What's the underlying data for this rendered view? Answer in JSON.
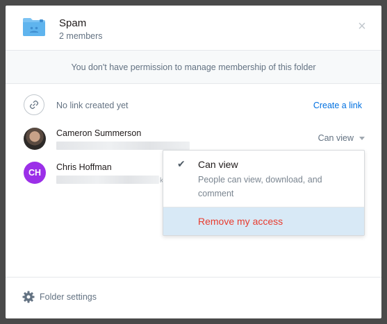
{
  "header": {
    "title": "Spam",
    "subtitle": "2 members",
    "folder_icon": "shared-folder-icon",
    "close_label": "×"
  },
  "banner": {
    "text": "You don't have permission to manage membership of this folder"
  },
  "link": {
    "icon": "link-icon",
    "status": "No link created yet",
    "create_label": "Create a link"
  },
  "members": [
    {
      "name": "Cameron Summerson",
      "avatar": "photo",
      "access": "Can view"
    },
    {
      "name": "Chris Hoffman",
      "avatar_initials": "CH",
      "avatar_color": "#9b2fe8",
      "email_tail": "k"
    }
  ],
  "access_dropdown": {
    "options": [
      {
        "label": "Can view",
        "description": "People can view, download, and comment",
        "selected": true
      },
      {
        "label": "Remove my access",
        "highlighted": true
      }
    ]
  },
  "footer": {
    "icon": "gear-icon",
    "label": "Folder settings"
  },
  "colors": {
    "accent": "#0070e0",
    "danger": "#e83b2e",
    "highlight": "#d8e9f6"
  }
}
